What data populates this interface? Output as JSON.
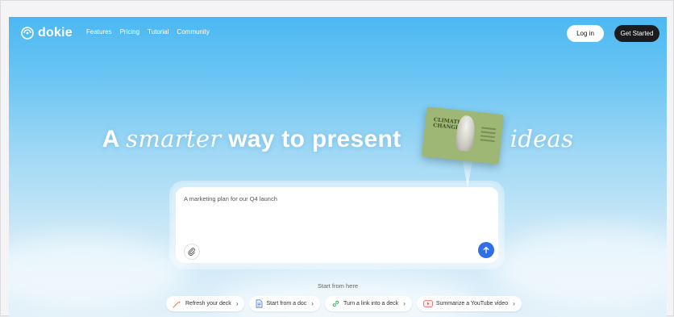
{
  "brand": {
    "name": "dokie"
  },
  "nav": {
    "links": [
      "Features",
      "Pricing",
      "Tutorial",
      "Community"
    ],
    "login_label": "Log in",
    "get_started_label": "Get Started"
  },
  "hero": {
    "word_a": "A",
    "word_smarter": "smarter",
    "phrase_middle": "way to present",
    "word_ideas": "ideas",
    "card_title_line1": "CLIMATE",
    "card_title_line2": "CHANGE"
  },
  "prompt": {
    "value": "A marketing plan for our Q4 launch"
  },
  "start": {
    "label": "Start from here",
    "chips": [
      {
        "label": "Refresh your deck",
        "icon": "sparkle-wand-icon"
      },
      {
        "label": "Start from a doc",
        "icon": "document-icon"
      },
      {
        "label": "Turn a link into a deck",
        "icon": "link-icon"
      },
      {
        "label": "Summarize a YouTube video",
        "icon": "youtube-icon"
      }
    ]
  },
  "colors": {
    "sky_top": "#4bb8f2",
    "sky_bottom": "#e2f1fa",
    "send_button": "#2f6fe6",
    "get_started_bg": "#1c1c1e"
  }
}
